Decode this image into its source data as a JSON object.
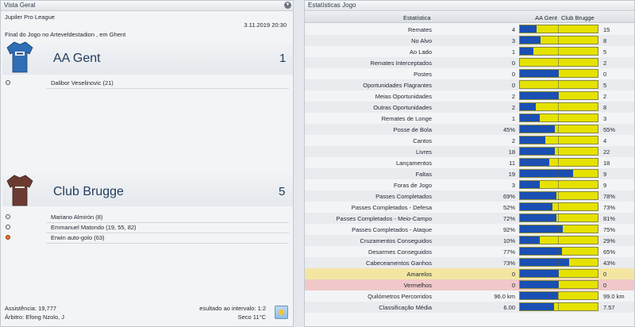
{
  "left_panel": {
    "title": "Vista Geral",
    "competition": "Jupiler Pro League",
    "datetime": "3.11.2019 20:30",
    "venue": "Final do Jogo no Arteveldestadion , em Ghent",
    "home": {
      "name": "AA Gent",
      "score": "1",
      "kit_color": "#2f6db5",
      "scorers": [
        {
          "text": "Dalibor Veselinovic (21)",
          "own_goal": false
        }
      ]
    },
    "away": {
      "name": "Club Brugge",
      "score": "5",
      "kit_color": "#6b3b32",
      "scorers": [
        {
          "text": "Mariano Almirón (8)",
          "own_goal": false
        },
        {
          "text": "Emmanuel Matondo (19, 55, 82)",
          "own_goal": false
        },
        {
          "text": "Erwin auto-golo (63)",
          "own_goal": true
        }
      ]
    },
    "attendance": "Assistência: 19,777",
    "referee": "Árbitro: Efong Nzolo, J",
    "halftime": "esultado ao intervalo: 1:2",
    "weather": "Seco 11°C",
    "weather_icon": "sunny-weather-icon"
  },
  "right_panel": {
    "title": "Estatísticas Jogo",
    "header": {
      "stat": "Estatística",
      "home": "AA Gent",
      "away": "Club Brugge"
    },
    "colors": {
      "home_bar": "#1a4fb3",
      "away_bar": "#e6e200"
    },
    "rows": [
      {
        "label": "Remates",
        "home": "4",
        "away": "15",
        "share": 0.21,
        "hl": ""
      },
      {
        "label": "No Alvo",
        "home": "3",
        "away": "8",
        "share": 0.27,
        "hl": ""
      },
      {
        "label": "Ao Lado",
        "home": "1",
        "away": "5",
        "share": 0.17,
        "hl": ""
      },
      {
        "label": "Remates Interceptados",
        "home": "0",
        "away": "2",
        "share": 0.0,
        "hl": ""
      },
      {
        "label": "Postes",
        "home": "0",
        "away": "0",
        "share": 0.5,
        "hl": ""
      },
      {
        "label": "Oportunidades Flagrantes",
        "home": "0",
        "away": "5",
        "share": 0.0,
        "hl": ""
      },
      {
        "label": "Meias Oportunidades",
        "home": "2",
        "away": "2",
        "share": 0.5,
        "hl": ""
      },
      {
        "label": "Outras Oportunidades",
        "home": "2",
        "away": "8",
        "share": 0.2,
        "hl": ""
      },
      {
        "label": "Remates de Longe",
        "home": "1",
        "away": "3",
        "share": 0.25,
        "hl": ""
      },
      {
        "label": "Posse de Bola",
        "home": "45%",
        "away": "55%",
        "share": 0.45,
        "hl": ""
      },
      {
        "label": "Cantos",
        "home": "2",
        "away": "4",
        "share": 0.33,
        "hl": ""
      },
      {
        "label": "Livres",
        "home": "18",
        "away": "22",
        "share": 0.45,
        "hl": ""
      },
      {
        "label": "Lançamentos",
        "home": "11",
        "away": "18",
        "share": 0.38,
        "hl": ""
      },
      {
        "label": "Faltas",
        "home": "19",
        "away": "9",
        "share": 0.68,
        "hl": ""
      },
      {
        "label": "Foras de Jogo",
        "home": "3",
        "away": "9",
        "share": 0.25,
        "hl": ""
      },
      {
        "label": "Passes Completados",
        "home": "69%",
        "away": "78%",
        "share": 0.47,
        "hl": ""
      },
      {
        "label": "Passes Completados - Defesa",
        "home": "52%",
        "away": "73%",
        "share": 0.42,
        "hl": ""
      },
      {
        "label": "Passes Completados - Meio-Campo",
        "home": "72%",
        "away": "81%",
        "share": 0.47,
        "hl": ""
      },
      {
        "label": "Passes Completados - Ataque",
        "home": "92%",
        "away": "75%",
        "share": 0.55,
        "hl": ""
      },
      {
        "label": "Cruzamentos Conseguidos",
        "home": "10%",
        "away": "29%",
        "share": 0.26,
        "hl": ""
      },
      {
        "label": "Desarmes Conseguidos",
        "home": "77%",
        "away": "65%",
        "share": 0.54,
        "hl": ""
      },
      {
        "label": "Cabeceamentos Ganhos",
        "home": "73%",
        "away": "43%",
        "share": 0.63,
        "hl": ""
      },
      {
        "label": "Amarelos",
        "home": "0",
        "away": "0",
        "share": 0.5,
        "hl": "yellow"
      },
      {
        "label": "Vermelhos",
        "home": "0",
        "away": "0",
        "share": 0.5,
        "hl": "red"
      },
      {
        "label": "Quilómetros Percorridos",
        "home": "96.0 km",
        "away": "99.0 km",
        "share": 0.49,
        "hl": ""
      },
      {
        "label": "Classificação Média",
        "home": "6.00",
        "away": "7.57",
        "share": 0.44,
        "hl": ""
      }
    ]
  }
}
